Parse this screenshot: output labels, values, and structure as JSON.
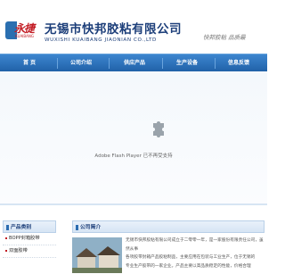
{
  "header": {
    "logo_script": "永捷",
    "logo_en": "KUAIBANG",
    "company_name": "无锡市快邦胶粘有限公司",
    "company_name_en": "WUXISHI KUAIBANG JIAONIAN CO.,LTD",
    "slogan": "快邦胶粘 品质最"
  },
  "nav": {
    "items": [
      "首 页",
      "公司介绍",
      "供应产品",
      "生产设备",
      "信息反馈"
    ]
  },
  "flash": {
    "message": "Adobe Flash Player 已不再受支持"
  },
  "sidebar": {
    "title": "产品类别",
    "items": [
      "BOPP封箱胶带",
      "双面胶带"
    ]
  },
  "about": {
    "title": "公司简介",
    "lines": [
      "无锡市快邦胶粘有限公司成立于二零零一年，是一家股份有限责任公司，虽然从事",
      "各项胶带封箱产品胶粘制品，主要应用在包装与工业生产，位于无锡的",
      "专业生产胶带的一家企业。产品主要以高品质稳定的性能，价格合理"
    ]
  },
  "colors": {
    "nav_blue": "#1f5fa6",
    "brand_red": "#c21a22",
    "title_blue": "#1d3f7a"
  }
}
